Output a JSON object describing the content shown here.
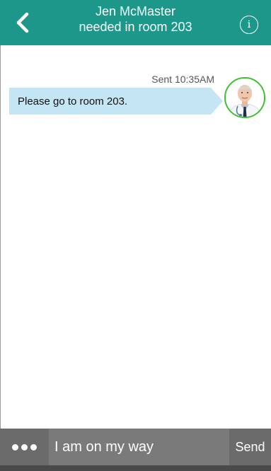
{
  "header": {
    "back_icon": "chevron-left-icon",
    "title_line1": "Jen McMaster",
    "title_line2": "needed in room 203",
    "info_icon": "info-circle-icon",
    "info_glyph": "i",
    "background": "#1d978a"
  },
  "conversation": {
    "messages": [
      {
        "status": "Sent 10:35AM",
        "text": "Please go to room 203.",
        "bubble_color": "#c4e6f4",
        "avatar_ring_color": "#3cbe2e"
      }
    ]
  },
  "composer": {
    "more_icon": "more-dots-icon",
    "input_value": "I am on my way",
    "send_label": "Send"
  }
}
